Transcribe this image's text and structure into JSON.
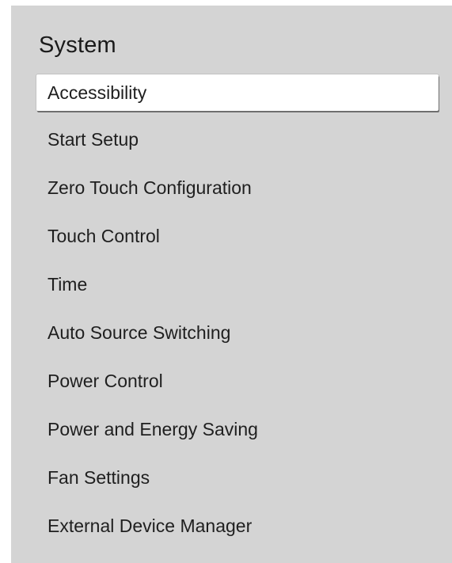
{
  "title": "System",
  "items": [
    {
      "label": "Accessibility",
      "selected": true
    },
    {
      "label": "Start Setup",
      "selected": false
    },
    {
      "label": "Zero Touch Configuration",
      "selected": false
    },
    {
      "label": "Touch Control",
      "selected": false
    },
    {
      "label": "Time",
      "selected": false
    },
    {
      "label": "Auto Source Switching",
      "selected": false
    },
    {
      "label": "Power Control",
      "selected": false
    },
    {
      "label": "Power and Energy Saving",
      "selected": false
    },
    {
      "label": "Fan Settings",
      "selected": false
    },
    {
      "label": "External Device Manager",
      "selected": false
    }
  ],
  "colors": {
    "panel_background": "#d4d4d4",
    "selected_background": "#ffffff",
    "text": "#1f1f1f"
  }
}
